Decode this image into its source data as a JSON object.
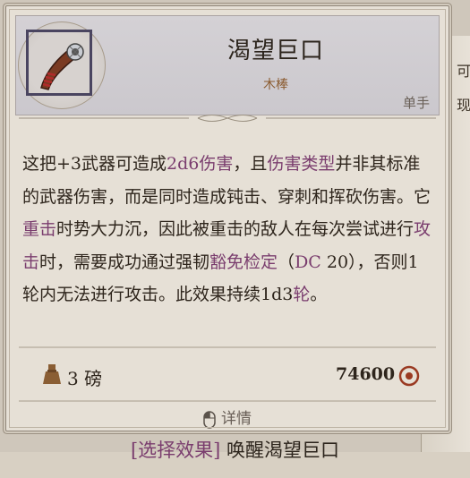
{
  "item": {
    "name": "渴望巨口",
    "type": "木棒",
    "handedness": "单手"
  },
  "description": [
    {
      "t": "这把+3武器可造成",
      "kw": false
    },
    {
      "t": "2d6伤害",
      "kw": true
    },
    {
      "t": "，且",
      "kw": false
    },
    {
      "t": "伤害类型",
      "kw": true
    },
    {
      "t": "并非其标准的武器伤害，而是同时造成钝击、穿刺和挥砍伤害。它",
      "kw": false
    },
    {
      "t": "重击",
      "kw": true
    },
    {
      "t": "时势大力沉，因此被重击的敌人在每次尝试进行",
      "kw": false
    },
    {
      "t": "攻击",
      "kw": true
    },
    {
      "t": "时，需要成功通过强韧",
      "kw": false
    },
    {
      "t": "豁免检定",
      "kw": true
    },
    {
      "t": "（",
      "kw": false
    },
    {
      "t": "DC",
      "kw": true
    },
    {
      "t": " 20），否则1轮内无法进行攻击。此效果持续1d3",
      "kw": false
    },
    {
      "t": "轮",
      "kw": true
    },
    {
      "t": "。",
      "kw": false
    }
  ],
  "stats": {
    "weight": "3 磅",
    "price": "74600"
  },
  "footer": {
    "details_label": "详情"
  },
  "action": {
    "tag": "[选择效果]",
    "label": " 唤醒渴望巨口"
  },
  "background": {
    "text_1": "可",
    "text_2": "现"
  },
  "colors": {
    "keyword": "#7a3d6e",
    "item_type": "#8a5a2e",
    "text": "#2e251c"
  },
  "icons": [
    "club-item-icon",
    "weight-icon",
    "coin-icon",
    "mouse-icon"
  ]
}
